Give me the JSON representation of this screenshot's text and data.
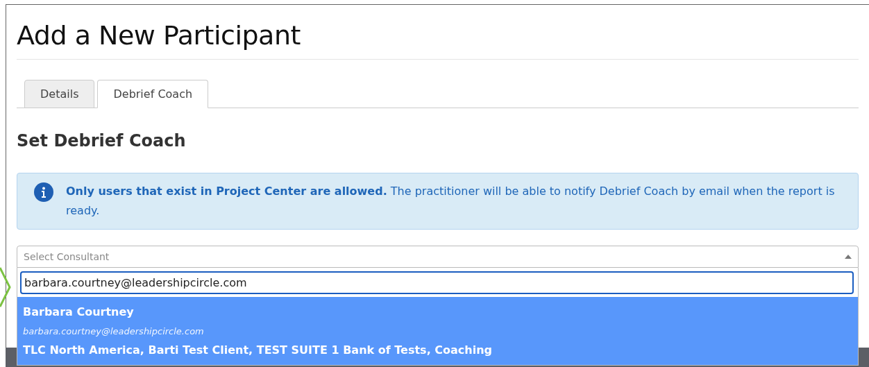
{
  "title": "Add a New Participant",
  "tabs": [
    {
      "label": "Details",
      "selected": false
    },
    {
      "label": "Debrief Coach",
      "selected": true
    }
  ],
  "section_heading": "Set Debrief Coach",
  "alert": {
    "text": "**Only users that exist in Project Center are allowed.** The practitioner will be able to notify Debrief Coach by email when the report is ready."
  },
  "select": {
    "placeholder": "Select Consultant",
    "expanded": true,
    "search_value": "barbara.courtney@leadershipcircle.com",
    "options": [
      {
        "name": "Barbara Courtney",
        "email": "barbara.courtney@leadershipcircle.com",
        "groups": "TLC North America, Barti Test Client, TEST SUITE 1 Bank of Tests, Coaching",
        "selected": true
      }
    ]
  }
}
